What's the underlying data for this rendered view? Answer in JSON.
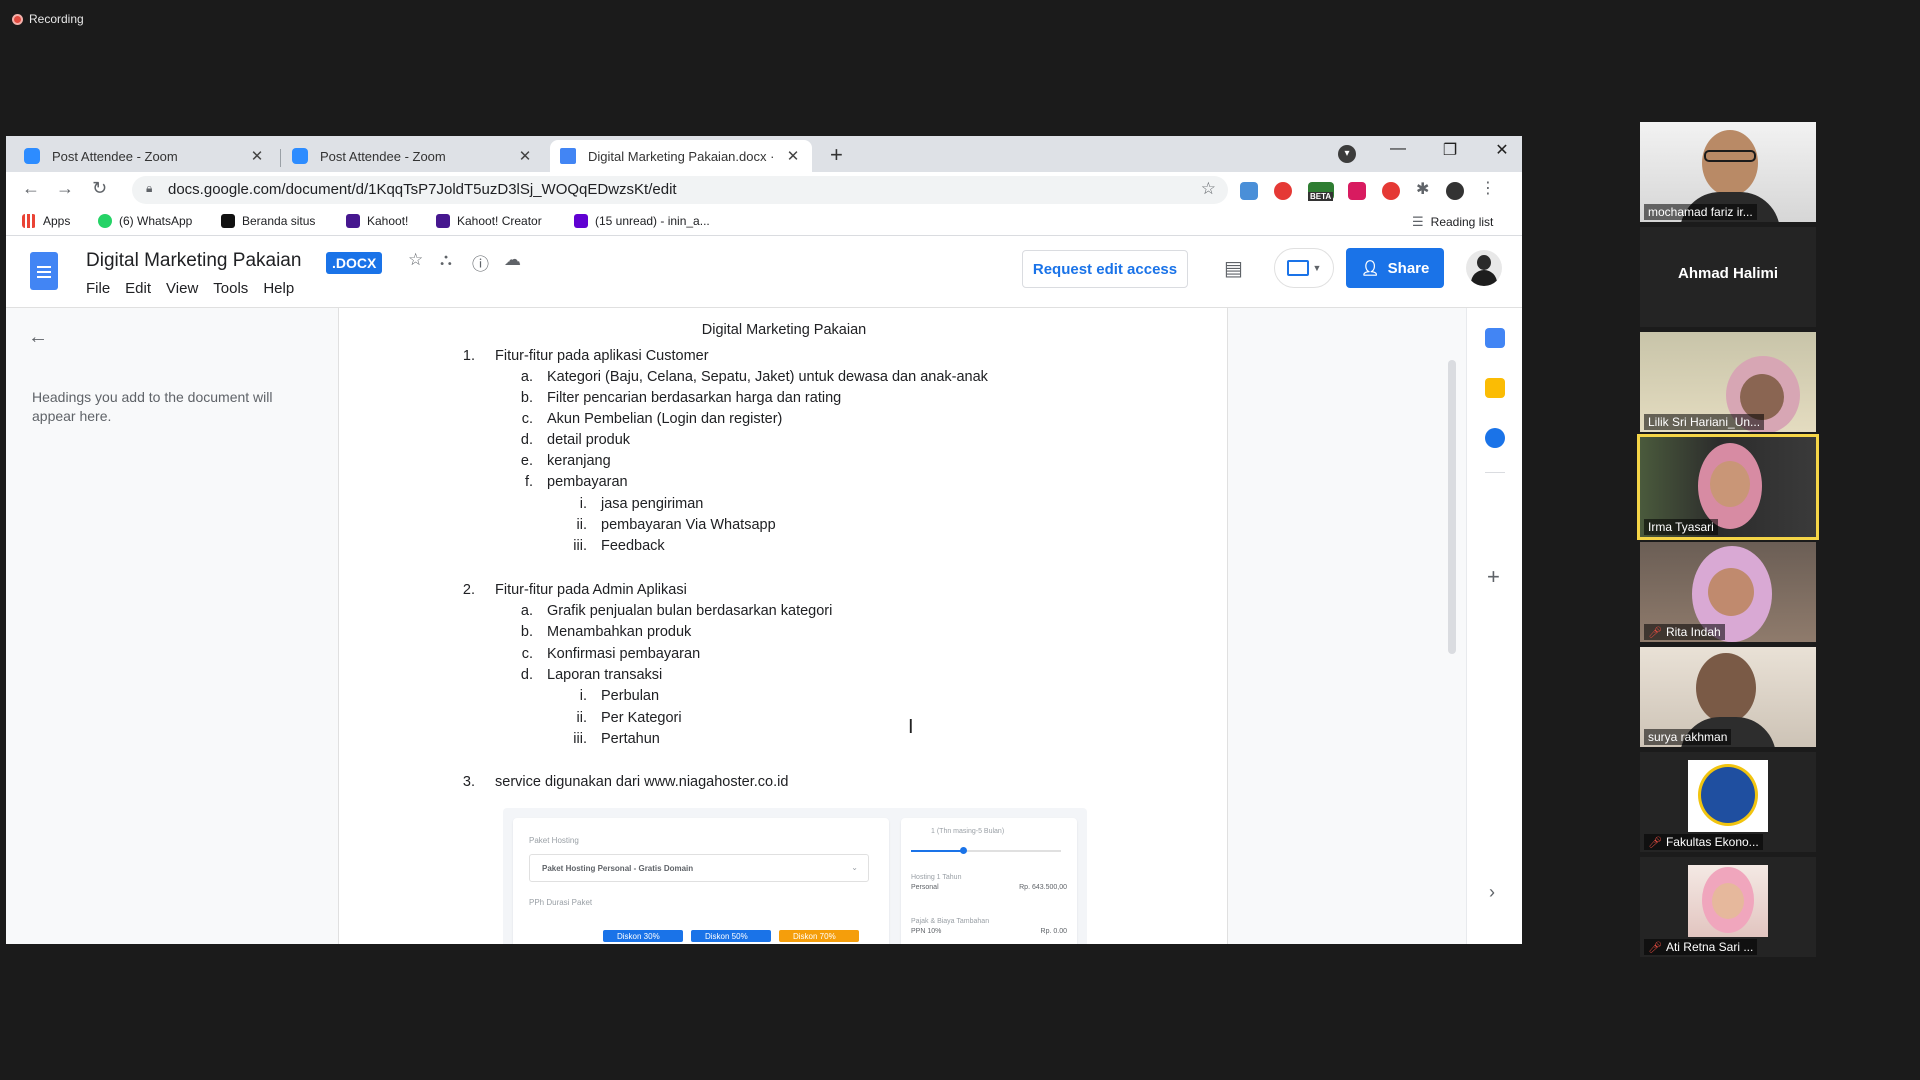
{
  "recording": "Recording",
  "browser": {
    "tabs": [
      {
        "title": "Post Attendee - Zoom",
        "close": "✕"
      },
      {
        "title": "Post Attendee - Zoom",
        "close": "✕"
      },
      {
        "title": "Digital Marketing Pakaian.docx ·",
        "close": "✕"
      }
    ],
    "new_tab": "+",
    "window_controls": {
      "minimize": "—",
      "restore": "❐",
      "close": "✕"
    },
    "url": "docs.google.com/document/d/1KqqTsP7JoldT5uzD3lSj_WOQqEDwzsKt/edit",
    "extension_badge": "BETA",
    "bookmarks": [
      {
        "label": "Apps"
      },
      {
        "label": "(6) WhatsApp"
      },
      {
        "label": "Beranda situs"
      },
      {
        "label": "Kahoot!"
      },
      {
        "label": "Kahoot! Creator"
      },
      {
        "label": "(15 unread) - inin_a..."
      }
    ],
    "reading_list": "Reading list"
  },
  "docs": {
    "title": "Digital Marketing Pakaian",
    "badge": ".DOCX",
    "menu": [
      "File",
      "Edit",
      "View",
      "Tools",
      "Help"
    ],
    "request_edit": "Request edit access",
    "share": "Share",
    "outline_message": "Headings you add to the document will appear here.",
    "page_title": "Digital Marketing Pakaian",
    "sections": [
      {
        "num": "1.",
        "text": "Fitur-fitur pada aplikasi Customer",
        "items": [
          {
            "mk": "a.",
            "text": "Kategori (Baju, Celana, Sepatu, Jaket) untuk dewasa dan anak-anak"
          },
          {
            "mk": "b.",
            "text": "Filter pencarian berdasarkan harga dan rating"
          },
          {
            "mk": "c.",
            "text": "Akun Pembelian (Login dan register)"
          },
          {
            "mk": "d.",
            "text": "detail produk"
          },
          {
            "mk": "e.",
            "text": "keranjang"
          },
          {
            "mk": "f.",
            "text": "pembayaran"
          }
        ],
        "subitems": [
          {
            "mk": "i.",
            "text": "jasa pengiriman"
          },
          {
            "mk": "ii.",
            "text": "pembayaran Via Whatsapp"
          },
          {
            "mk": "iii.",
            "text": "Feedback"
          }
        ]
      },
      {
        "num": "2.",
        "text": "Fitur-fitur pada Admin Aplikasi",
        "items": [
          {
            "mk": "a.",
            "text": "Grafik penjualan bulan berdasarkan kategori"
          },
          {
            "mk": "b.",
            "text": "Menambahkan produk"
          },
          {
            "mk": "c.",
            "text": "Konfirmasi pembayaran"
          },
          {
            "mk": "d.",
            "text": "Laporan transaksi"
          }
        ],
        "subitems": [
          {
            "mk": "i.",
            "text": "Perbulan"
          },
          {
            "mk": "ii.",
            "text": "Per Kategori"
          },
          {
            "mk": "iii.",
            "text": "Pertahun"
          }
        ]
      },
      {
        "num": "3.",
        "text": "service digunakan dari www.niagahoster.co.id"
      }
    ],
    "embedded_image": {
      "label_hosting": "Paket Hosting",
      "select_value": "Paket Hosting Personal - Gratis Domain",
      "label_pph": "PPh Durasi Paket",
      "slider_label": "1 (Thn masing-5 Bulan)",
      "row1_label": "Hosting 1 Tahun",
      "row1_sub": "Personal",
      "row1_value": "Rp. 643.500,00",
      "row2_label": "Pajak & Biaya Tambahan",
      "row2_sub": "PPN 10%",
      "row2_value": "Rp. 0.00",
      "btn1": "Diskon 30%",
      "btn2": "Diskon 50%",
      "btn3": "Diskon 70%",
      "accent_blue": "#1a73e8",
      "accent_orange": "#f59e0b"
    }
  },
  "zoom": {
    "participants": [
      {
        "name": "mochamad fariz ir...",
        "muted": false
      },
      {
        "name": "Ahmad Halimi",
        "muted": false,
        "video": false
      },
      {
        "name": "Lilik Sri Hariani_Un...",
        "muted": false
      },
      {
        "name": "Irma Tyasari",
        "muted": false,
        "speaking": true
      },
      {
        "name": "Rita Indah",
        "muted": true
      },
      {
        "name": "surya rakhman",
        "muted": false
      },
      {
        "name": "Fakultas Ekono...",
        "muted": true
      },
      {
        "name": "Ati Retna Sari ...",
        "muted": true
      }
    ]
  }
}
